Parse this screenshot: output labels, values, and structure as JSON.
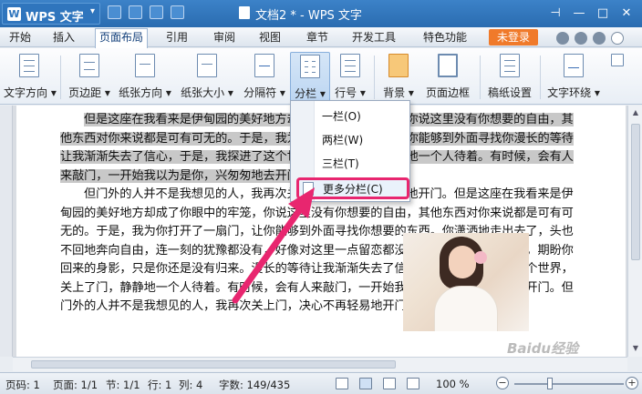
{
  "titlebar": {
    "app_name": "WPS 文字",
    "doc_title": "文档2 * - WPS 文字"
  },
  "menu": {
    "tabs": [
      "开始",
      "插入",
      "页面布局",
      "引用",
      "审阅",
      "视图",
      "章节",
      "开发工具",
      "特色功能"
    ],
    "active_tab": "页面布局",
    "login": "未登录"
  },
  "ribbon": {
    "buttons": [
      {
        "label": "文字方向 ▾",
        "icon": "text-direction-icon"
      },
      {
        "label": "页边距 ▾",
        "icon": "margins-icon"
      },
      {
        "label": "纸张方向 ▾",
        "icon": "orientation-icon"
      },
      {
        "label": "纸张大小 ▾",
        "icon": "paper-size-icon"
      },
      {
        "label": "分隔符 ▾",
        "icon": "separator-icon"
      },
      {
        "label": "分栏 ▾",
        "icon": "columns-icon"
      },
      {
        "label": "行号 ▾",
        "icon": "line-number-icon"
      },
      {
        "label": "背景 ▾",
        "icon": "background-icon"
      },
      {
        "label": "页面边框",
        "icon": "page-border-icon"
      },
      {
        "label": "稿纸设置",
        "icon": "manuscript-icon"
      },
      {
        "label": "文字环绕 ▾",
        "icon": "text-wrap-icon"
      }
    ]
  },
  "dropdown": {
    "items": [
      "一栏(O)",
      "两栏(W)",
      "三栏(T)"
    ],
    "more": "更多分栏(C)"
  },
  "document": {
    "para1": "但是这座在我看来是伊甸园的美好地方却成了你眼中的牢笼，你说这里没有你想要的自由，其他东西对你来说都是可有可无的。于是，我为你打开了一扇门，让你能够到外面寻找你漫长的等待让我渐渐失去了信心，于是，我探进了这个世界，关上了门，静静地一个人待着。有时候，会有人来敲门，一开始我以为是你，兴匆匆地去开门。",
    "para2": "但门外的人并不是我想见的人，我再次关上门，决心不再轻易地开门。但是这座在我看来是伊甸园的美好地方却成了你眼中的牢笼，你说这里没有你想要的自由，其他东西对你来说都是可有可无的。于是，我为你打开了一扇门，让你能够到外面寻找你想要的东西。你潇洒地走出去了，头也不回地奔向自由，连一刻的犹豫都没有，好像对这里一点留恋都没有。我每天守候在门外，期盼你回来的身影，只是你还是没有归来。漫长的等待让我渐渐失去了信心，于是，我探进了这个世界，关上了门，静静地一个人待着。有时候，会有人来敲门，一开始我以为是你，兴匆匆地去开门。但门外的人并不是我想见的人，我再次关上门，决心不再轻易地开门。"
  },
  "status": {
    "page_num": "页码: 1",
    "pages": "页面: 1/1",
    "section": "节: 1/1",
    "row": "行: 1",
    "col": "列: 4",
    "words": "字数: 149/435",
    "zoom": "100 %"
  },
  "watermark": "Baidu经验"
}
